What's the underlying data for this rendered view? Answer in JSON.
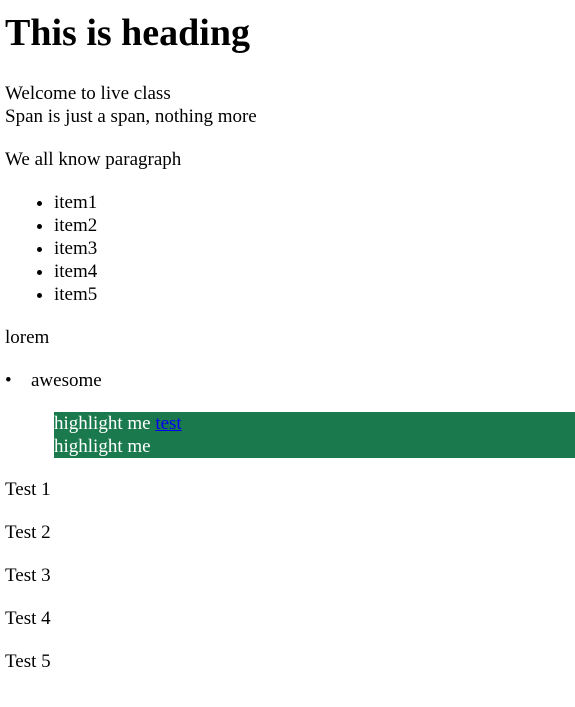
{
  "heading": "This is heading",
  "intro": {
    "welcome": "Welcome to live class",
    "span_text": "Span is just a span, nothing more"
  },
  "paragraph": "We all know paragraph",
  "list_items": [
    "item1",
    "item2",
    "item3",
    "item4",
    "item5"
  ],
  "lorem": "lorem",
  "awesome_item": "awesome",
  "highlight": {
    "line1": "highlight me",
    "link": "test",
    "line2": "highlight me",
    "background_color": "#1a7a4e"
  },
  "tests": [
    "Test 1",
    "Test 2",
    "Test 3",
    "Test 4",
    "Test 5"
  ]
}
